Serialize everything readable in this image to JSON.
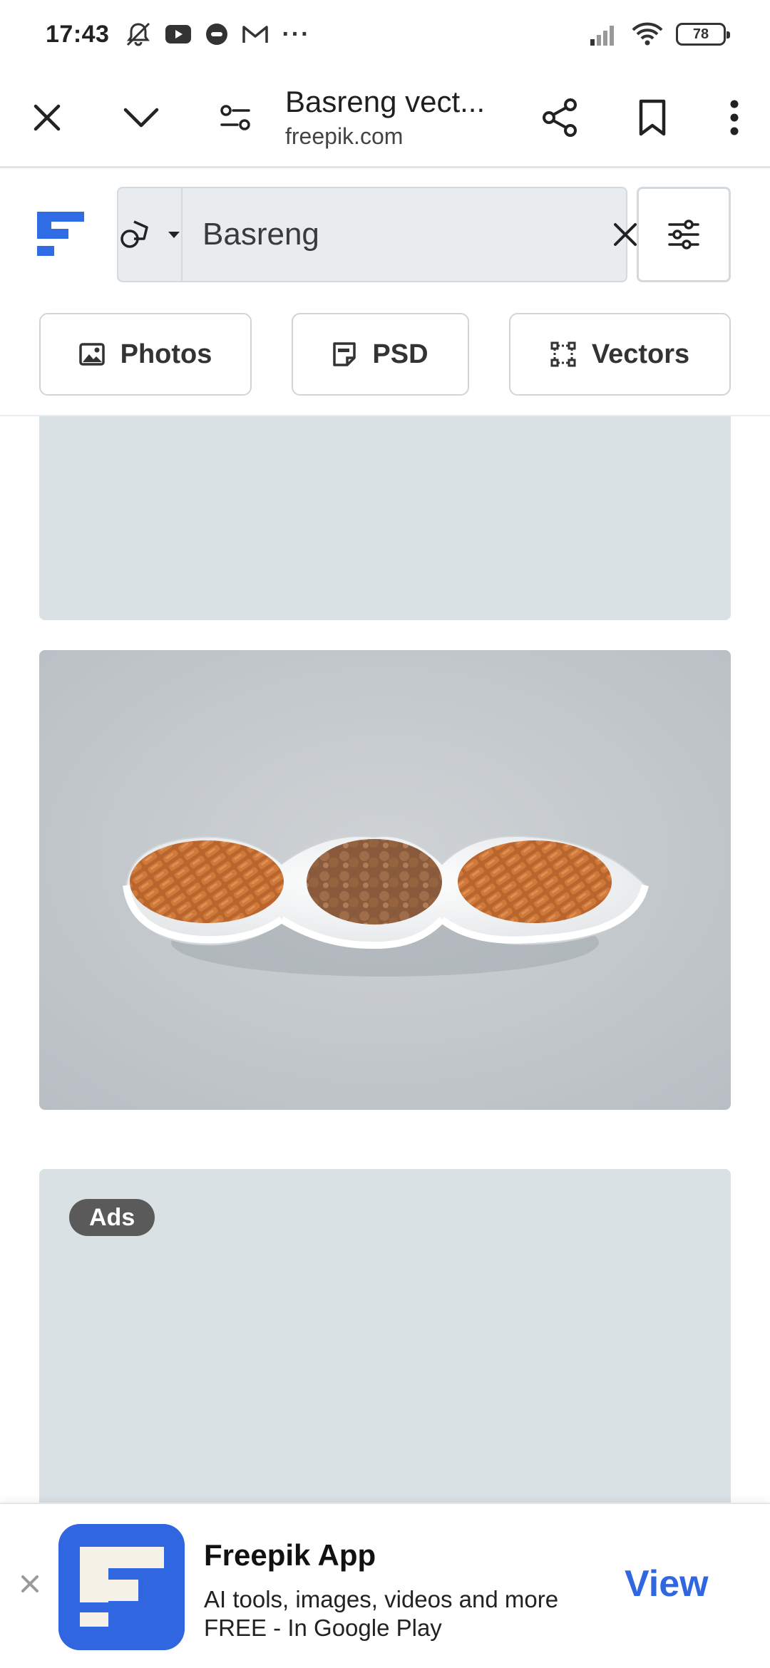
{
  "status_bar": {
    "time": "17:43",
    "battery": "78",
    "more_indicator": "···",
    "icons": [
      "silent-bell-icon",
      "youtube-icon",
      "chat-bubble-icon",
      "gmail-icon",
      "signal-icon",
      "wifi-icon"
    ]
  },
  "tab_bar": {
    "title": "Basreng vect...",
    "domain": "freepik.com",
    "icons": [
      "close-icon",
      "chevron-down-icon",
      "site-settings-icon",
      "share-icon",
      "bookmark-icon",
      "more-vert-icon"
    ]
  },
  "search": {
    "query": "Basreng",
    "type_icon": "shapes-icon",
    "accent": "#2f6ce5"
  },
  "type_filters": [
    {
      "label": "Photos",
      "icon": "image-icon"
    },
    {
      "label": "PSD",
      "icon": "psd-file-icon"
    },
    {
      "label": "Vectors",
      "icon": "vector-icon"
    }
  ],
  "ads": {
    "badge": "Ads"
  },
  "app_banner": {
    "title": "Freepik App",
    "desc_line1": "AI tools, images, videos and more",
    "desc_line2": "FREE - In Google Play",
    "action": "View",
    "accent": "#3067e0"
  },
  "colors": {
    "placeholder": "#d9e1e5",
    "brand_blue": "#2f6ce5"
  }
}
